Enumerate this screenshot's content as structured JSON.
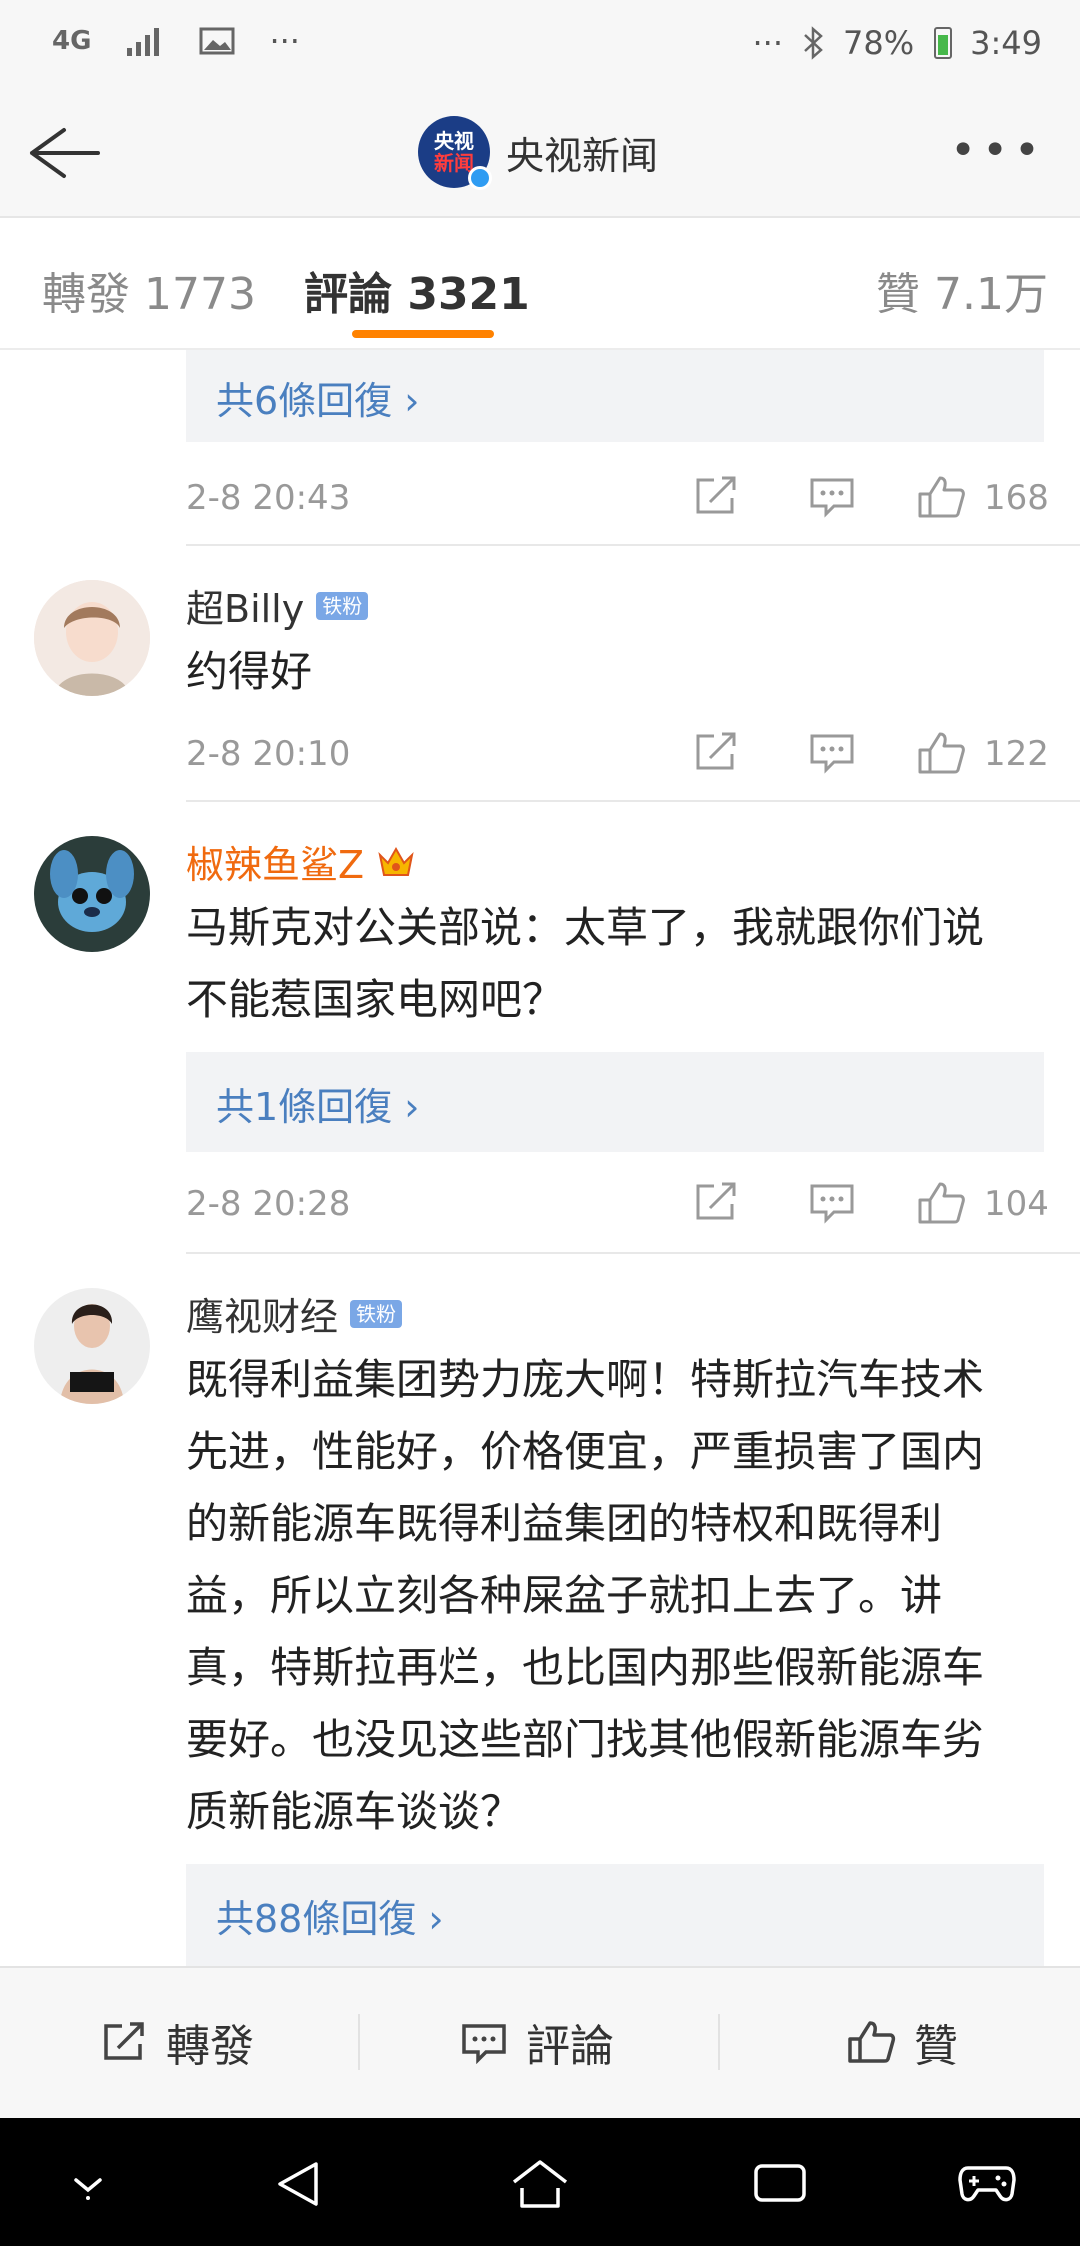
{
  "status_bar": {
    "network": "4G",
    "signal": "signal",
    "misc": "···",
    "right_misc": "···",
    "battery": "78%",
    "time": "3:49"
  },
  "header": {
    "account_name": "央视新闻",
    "logo_line1": "央视",
    "logo_line2": "新闻",
    "more": "•••"
  },
  "tabs": {
    "repost": {
      "label": "轉發",
      "count": "1773"
    },
    "comments": {
      "label": "評論",
      "count": "3321"
    },
    "likes": {
      "label": "贊",
      "count": "7.1万"
    }
  },
  "comments": [
    {
      "reply_link": "共6條回復 ›",
      "time": "2-8 20:43",
      "likes": "168"
    },
    {
      "user": "超Billy",
      "badge": "铁粉",
      "text": "约得好",
      "time": "2-8 20:10",
      "likes": "122"
    },
    {
      "user": "椒辣鱼鲨Z",
      "text_line1": "马斯克对公关部说：太草了，我就跟你们说",
      "text_line2": "不能惹国家电网吧？",
      "reply_link": "共1條回復 ›",
      "time": "2-8 20:28",
      "likes": "104"
    },
    {
      "user": "鹰视财经",
      "badge": "铁粉",
      "text_lines": [
        "既得利益集团势力庞大啊！特斯拉汽车技术",
        "先进，性能好，价格便宜，严重损害了国内",
        "的新能源车既得利益集团的特权和既得利",
        "益，所以立刻各种屎盆子就扣上去了。讲",
        "真，特斯拉再烂，也比国内那些假新能源车",
        "要好。也没见这些部门找其他假新能源车劣",
        "质新能源车谈谈？"
      ],
      "reply_link": "共88條回復 ›"
    }
  ],
  "action_bar": {
    "repost": "轉發",
    "comment": "評論",
    "like": "贊"
  },
  "colors": {
    "accent": "#ff8200",
    "link": "#4a7fbf",
    "vip_name": "#f06a0f"
  }
}
